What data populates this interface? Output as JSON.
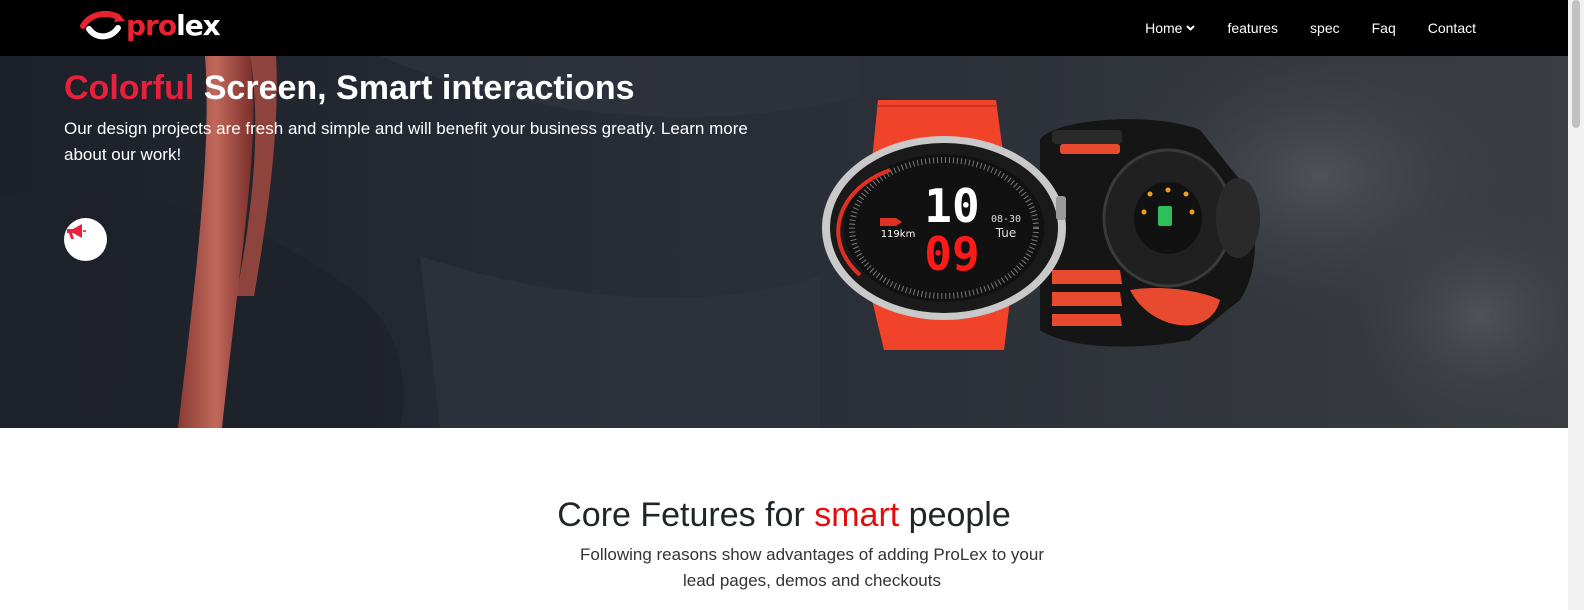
{
  "brand": {
    "name_part1": "pro",
    "name_part2": "lex",
    "colors": {
      "accent": "#e8222f",
      "nav_bg": "#000000"
    }
  },
  "nav": {
    "items": [
      {
        "label": "Home",
        "has_dropdown": true
      },
      {
        "label": "features"
      },
      {
        "label": "spec"
      },
      {
        "label": "Faq"
      },
      {
        "label": "Contact"
      }
    ]
  },
  "hero": {
    "title_accent": "Colorful",
    "title_rest": " Screen, Smart interactions",
    "subtitle": "Our design projects are fresh and simple and will benefit your business greatly. Learn more about our work!",
    "promo_icon": "megaphone-icon",
    "watch": {
      "hour": "10",
      "minute": "09",
      "distance": "119km",
      "date": "08-30",
      "day": "Tue"
    }
  },
  "features": {
    "title_before": "Core Fetures for ",
    "title_accent": "smart",
    "title_after": " people",
    "subtitle": "Following reasons show advantages of adding ProLex to your lead pages, demos and checkouts"
  }
}
